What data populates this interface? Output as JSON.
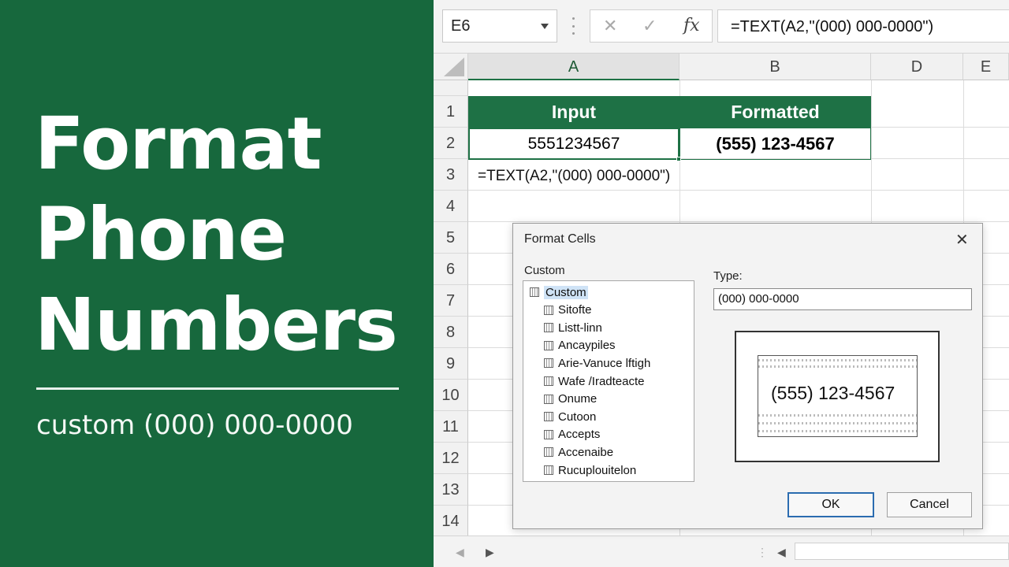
{
  "banner": {
    "title_lines": [
      "Format",
      "Phone",
      "Numbers"
    ],
    "subtitle": "custom (000) 000-0000"
  },
  "formula_bar": {
    "name_box": "E6",
    "cancel_icon": "✕",
    "enter_icon": "✓",
    "fx_label": "fx",
    "formula": "=TEXT(A2,\"(000) 000-0000\")"
  },
  "columns": [
    "A",
    "B",
    "D",
    "E"
  ],
  "rows": [
    "1",
    "2",
    "3",
    "4",
    "5",
    "6",
    "7",
    "8",
    "9",
    "10",
    "11",
    "12",
    "13",
    "14"
  ],
  "cells": {
    "A1": "Input",
    "B1": "Formatted",
    "A2": "5551234567",
    "B2": "(555) 123-4567",
    "A3": "=TEXT(A2,\"(000) 000-0000\")"
  },
  "dialog": {
    "title": "Format Cells",
    "close": "✕",
    "category_label": "Custom",
    "categories": [
      "Custom",
      "Sitofte",
      "Listt-linn",
      "Ancaypiles",
      "Arie-Vanuce lftigh",
      "Wafe /Iradteacte",
      "Onume",
      "Cutoon",
      "Accepts",
      "Accenaibe",
      "Rucuplouitelon"
    ],
    "type_label": "Type:",
    "type_value": "(000) 000-0000",
    "sample": "(555) 123-4567",
    "ok": "OK",
    "cancel": "Cancel"
  },
  "colors": {
    "banner_green": "#17683d",
    "header_green": "#1e7145",
    "ok_border": "#2b6cb0"
  },
  "icons": [
    "chevron-down-icon",
    "close-icon",
    "check-icon",
    "fx-icon",
    "format-category-icon",
    "scroll-left-icon",
    "scroll-right-icon"
  ]
}
